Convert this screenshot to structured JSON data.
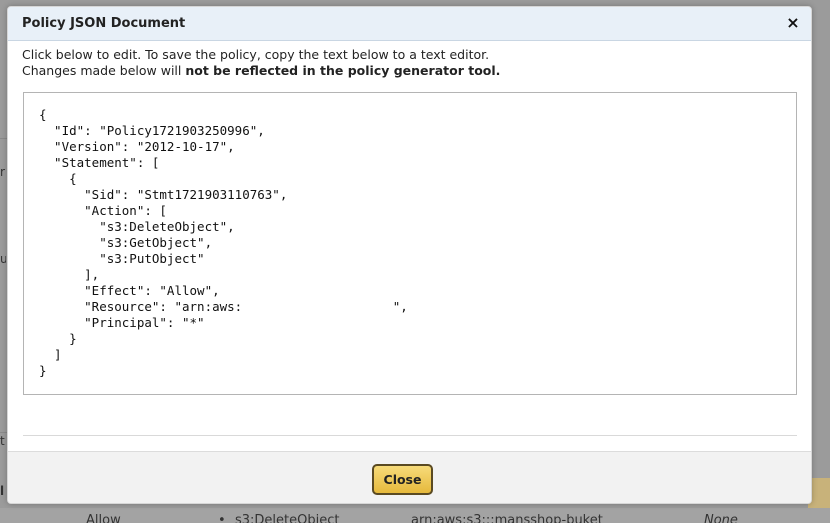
{
  "modal": {
    "title": "Policy JSON Document",
    "close_icon": "×",
    "intro_line1": "Click below to edit. To save the policy, copy the text below to a text editor.",
    "intro_line2_prefix": "Changes made below will ",
    "intro_line2_bold": "not be reflected in the policy generator tool.",
    "policy_json": "{\n  \"Id\": \"Policy1721903250996\",\n  \"Version\": \"2012-10-17\",\n  \"Statement\": [\n    {\n      \"Sid\": \"Stmt1721903110763\",\n      \"Action\": [\n        \"s3:DeleteObject\",\n        \"s3:GetObject\",\n        \"s3:PutObject\"\n      ],\n      \"Effect\": \"Allow\",\n      \"Resource\": \"arn:aws:                    \",\n      \"Principal\": \"*\"\n    }\n  ]\n}",
    "close_button_label": "Close"
  },
  "background": {
    "row": {
      "effect": "Allow",
      "bullet": "•",
      "action": "s3:DeleteObject",
      "resource": "arn:aws:s3:::mansshop-buket",
      "conditions": "None"
    },
    "edge_fragments": [
      "r",
      "u",
      "t",
      "l"
    ]
  },
  "colors": {
    "titlebar": "#e8f0f8",
    "button_gold": "#e6b93c",
    "overlay": "#9b9b9b"
  },
  "icons": {
    "close": "close-icon"
  }
}
